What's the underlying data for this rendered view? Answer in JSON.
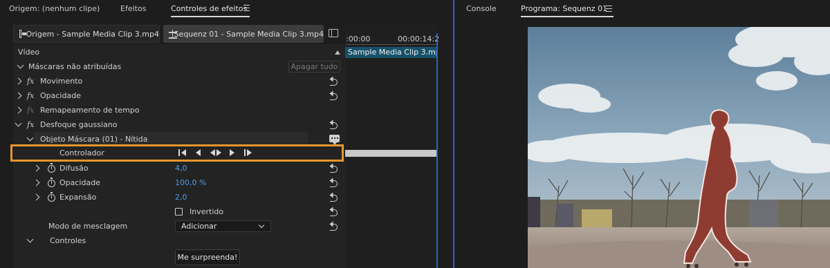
{
  "left_tabs": {
    "source": "Origem: (nenhum clipe)",
    "effects": "Efeitos",
    "effect_controls": "Controles de efeitos"
  },
  "source_bar": {
    "origin_label": "Origem - Sample Media Clip 3.mp4",
    "sequence_label": "Sequenz 01 - Sample Media Clip 3.mp4"
  },
  "timeline": {
    "start_time": ":00:00",
    "end_time": "00:00:14:2",
    "clip_label": "Sample Media Clip 3.mp4"
  },
  "effects": {
    "video_header": "Vídeo",
    "unassigned_masks": "Máscaras não atribuídas",
    "clear_all": "Apagar tudo",
    "motion": "Movimento",
    "opacity": "Opacidade",
    "time_remap": "Remapeamento de tempo",
    "gaussian_blur": "Desfoque gaussiano",
    "mask_object": "Objeto Máscara (01) - Nítida",
    "controller": "Controlador",
    "feather_label": "Difusão",
    "feather_value": "4,0",
    "mask_opacity_label": "Opacidade",
    "mask_opacity_value": "100,0 %",
    "expansion_label": "Expansão",
    "expansion_value": "2,0",
    "inverted_label": "Invertido",
    "blend_mode_label": "Modo de mesclagem",
    "blend_mode_value": "Adicionar",
    "controls_label": "Controles",
    "surprise_button": "Me surpreenda!"
  },
  "right_tabs": {
    "console": "Console",
    "program": "Programa: Sequenz 01"
  },
  "icons": [
    "menu-icon",
    "clip-icon",
    "sequence-icon",
    "panel-toggle-icon",
    "reset-icon",
    "stopwatch-icon",
    "speech-bubble-icon",
    "step-back-icon",
    "back-icon",
    "back-forward-icon",
    "forward-icon",
    "step-forward-icon"
  ],
  "colors": {
    "accent_blue": "#2a64c4",
    "value_blue": "#4d9de8",
    "highlight_orange": "#e8962d",
    "clip_teal": "#18526a",
    "mask_red": "#8e3b32"
  }
}
